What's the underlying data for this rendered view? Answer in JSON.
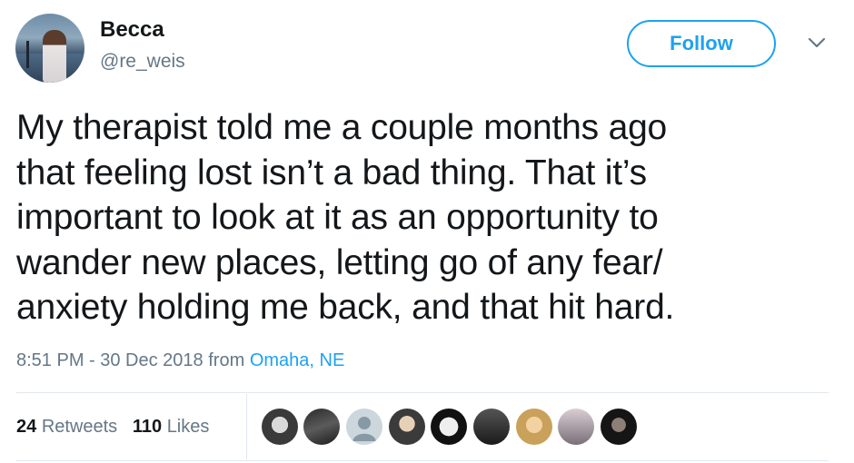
{
  "tweet": {
    "user": {
      "display_name": "Becca",
      "handle": "@re_weis",
      "avatar": "profile-avatar"
    },
    "follow_label": "Follow",
    "menu_icon": "chevron-down-icon",
    "text_lines": [
      "My therapist told me a couple months ago",
      "that feeling lost isn’t a bad thing. That it’s",
      "important to look at it as an opportunity to",
      "wander new places, letting go of any fear/",
      "anxiety holding me back, and that hit hard."
    ],
    "timestamp": "8:51 PM - 30 Dec 2018",
    "from_label": "from",
    "location": "Omaha, NE",
    "stats": {
      "retweets_count": "24",
      "retweets_label": "Retweets",
      "likes_count": "110",
      "likes_label": "Likes"
    },
    "liker_avatars": [
      "liker-avatar-1",
      "liker-avatar-2",
      "liker-avatar-3",
      "liker-avatar-4",
      "liker-avatar-5",
      "liker-avatar-6",
      "liker-avatar-7",
      "liker-avatar-8",
      "liker-avatar-9"
    ]
  },
  "colors": {
    "accent": "#1da1f2",
    "text": "#14171a",
    "secondary": "#657786",
    "divider": "#e1e8ed"
  }
}
